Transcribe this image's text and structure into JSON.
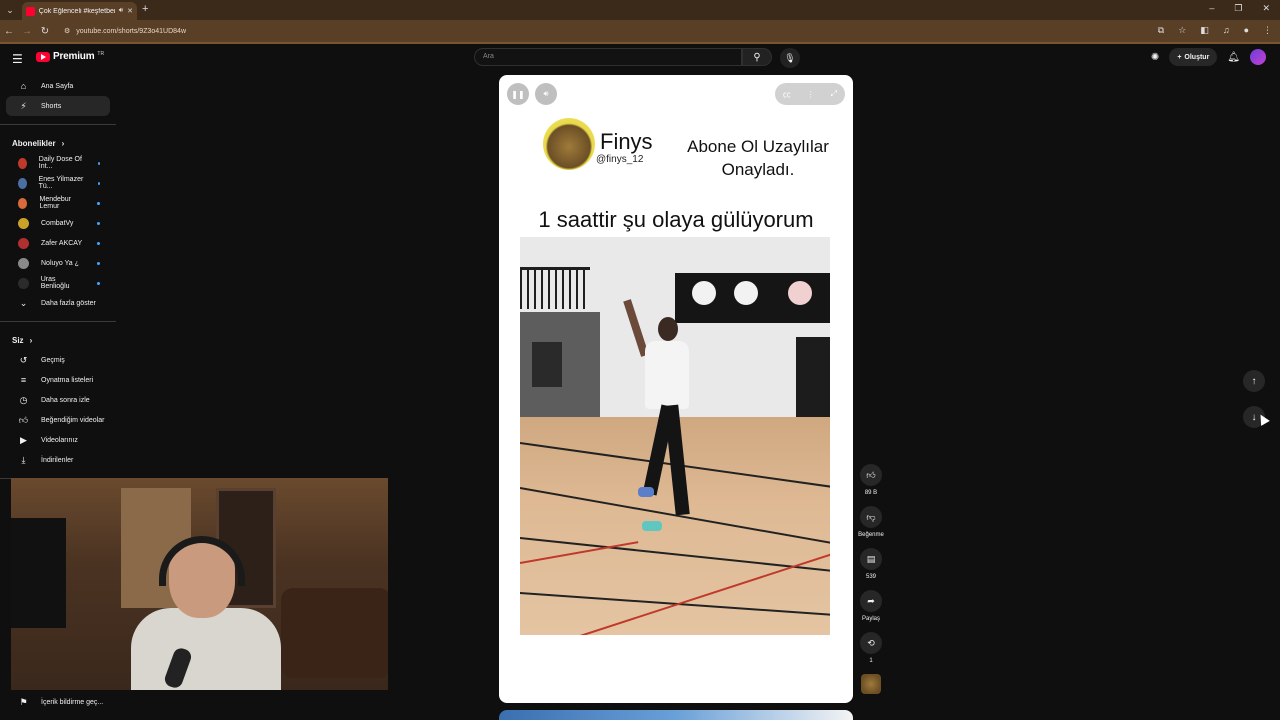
{
  "browser": {
    "tab_title": "Çok Eğlenceli #keşfetbeniö...",
    "url": "youtube.com/shorts/9Z3o41UD84w"
  },
  "header": {
    "logo_text": "Premium",
    "logo_country": "TR",
    "search_placeholder": "Ara",
    "create_label": "Oluştur"
  },
  "sidebar": {
    "home": "Ana Sayfa",
    "shorts": "Shorts",
    "subscriptions_title": "Abonelikler",
    "subscriptions": [
      {
        "name": "Daily Dose Of Int...",
        "color": "#c0392b"
      },
      {
        "name": "Enes Yilmazer Tü...",
        "color": "#4a6fa5"
      },
      {
        "name": "Mendebur Lemur",
        "color": "#d96a3a"
      },
      {
        "name": "CombatVy",
        "color": "#c9a227"
      },
      {
        "name": "Zafer AKCAY",
        "color": "#b03030"
      },
      {
        "name": "Noluyo Ya ¿",
        "color": "#8a8a8a"
      },
      {
        "name": "Uras Benlioğlu",
        "color": "#2b2b2b"
      }
    ],
    "show_more": "Daha fazla göster",
    "you_title": "Siz",
    "you_items": [
      {
        "label": "Geçmiş",
        "icon": "history-icon"
      },
      {
        "label": "Oynatma listeleri",
        "icon": "playlist-icon"
      },
      {
        "label": "Daha sonra izle",
        "icon": "clock-icon"
      },
      {
        "label": "Beğendiğim videolar",
        "icon": "thumbs-up-icon"
      },
      {
        "label": "Videolarınız",
        "icon": "video-icon"
      },
      {
        "label": "İndirilenler",
        "icon": "download-icon"
      }
    ],
    "report": "İçerik bildirme geç..."
  },
  "short": {
    "channel_name": "Finys",
    "channel_handle": "@finys_12",
    "message_line1": "Abone Ol Uzaylılar",
    "message_line2": "Onayladı.",
    "caption": "1 saattir şu olaya gülüyorum"
  },
  "actions": {
    "likes": "89 B",
    "dislike_label": "Beğenme",
    "comments": "539",
    "share_label": "Paylaş",
    "remix_count": "1"
  },
  "colors": {
    "accent_red": "#ff0033",
    "background": "#0f0f0f",
    "browser_frame": "#5a3f27"
  }
}
